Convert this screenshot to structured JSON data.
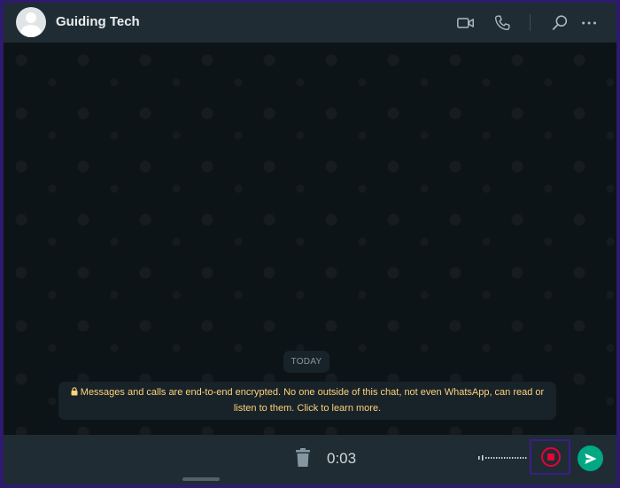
{
  "header": {
    "contact_name": "Guiding Tech",
    "icons": [
      "avatar",
      "video-call-icon",
      "voice-call-icon",
      "search-icon",
      "menu-icon"
    ]
  },
  "chat": {
    "date_label": "TODAY",
    "encryption_notice": "Messages and calls are end-to-end encrypted. No one outside of this chat, not even WhatsApp, can read or listen to them. Click to learn more."
  },
  "footer": {
    "recording_time": "0:03",
    "icons": [
      "trash-icon",
      "waveform-icon",
      "stop-icon",
      "send-icon"
    ]
  },
  "colors": {
    "header_bg": "#202c33",
    "chat_bg": "#0b141a",
    "notice_text": "#ffd279",
    "record_red": "#ea0038",
    "send_green": "#00a884",
    "frame_border": "#2e1a6e"
  }
}
